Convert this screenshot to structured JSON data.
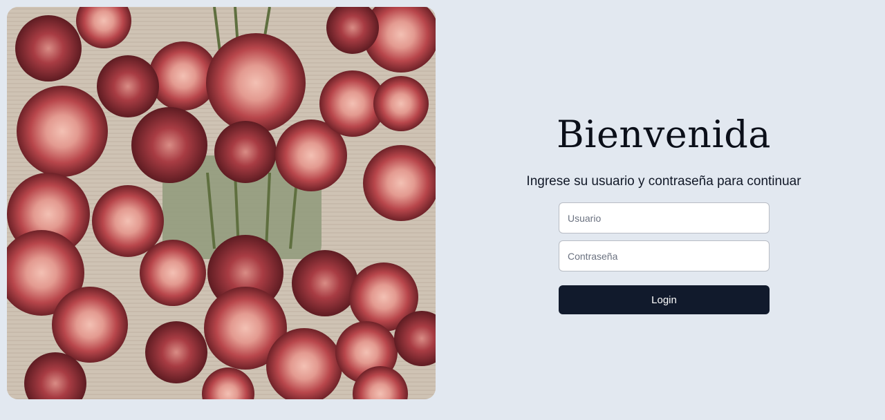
{
  "hero_image": {
    "subject": "bouquet of red and pink roses in a glass vase",
    "colors": {
      "rose_dark": "#8a2f34",
      "rose_mid": "#b8464b",
      "rose_light": "#e8a49b",
      "vase": "#8f9a7a",
      "rug": "#cfc3b4"
    }
  },
  "login": {
    "title": "Bienvenida",
    "subtitle": "Ingrese su usuario y contraseña para continuar",
    "username_placeholder": "Usuario",
    "password_placeholder": "Contraseña",
    "login_label": "Login"
  },
  "colors": {
    "background": "#e2e8f0",
    "button": "#111a2c",
    "button_text": "#ffffff"
  }
}
